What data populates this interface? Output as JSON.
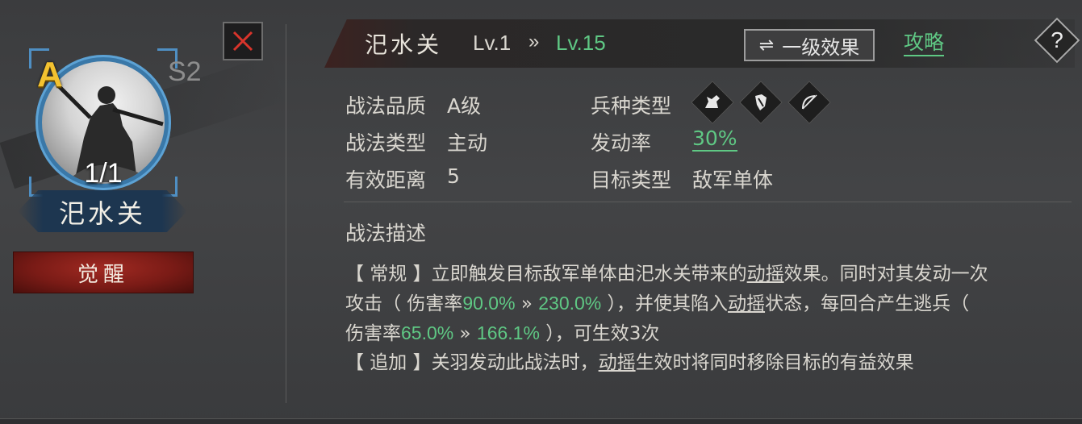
{
  "hero": {
    "grade": "A",
    "season": "S2",
    "count": "1/1",
    "name": "汜水关",
    "awaken_label": "觉醒"
  },
  "header": {
    "skill_name": "汜水关",
    "level_from": "Lv.1",
    "level_arrow": "»",
    "level_to": "Lv.15",
    "effect_button_icon": "⇌",
    "effect_button_label": "一级效果",
    "guide_link": "攻略",
    "help_label": "?"
  },
  "info": {
    "quality_label": "战法品质",
    "quality_value": "A级",
    "type_label": "战法类型",
    "type_value": "主动",
    "range_label": "有效距离",
    "range_value": "5",
    "troop_label": "兵种类型",
    "troop_icons": [
      "cavalry-icon",
      "shield-icon",
      "bow-icon"
    ],
    "rate_label": "发动率",
    "rate_value": "30%",
    "target_label": "目标类型",
    "target_value": "敌军单体"
  },
  "description": {
    "title": "战法描述",
    "l1a": "【 常规 】立即触发目标敌军单体由汜水关带来的",
    "l1b": "动摇",
    "l1c": "效果。同时对其发动一次",
    "l2a": "攻击（ 伤害率",
    "l2b": "90.0%",
    "l2c": " » ",
    "l2d": "230.0%",
    "l2e": " ），并使其陷入",
    "l2f": "动摇",
    "l2g": "状态，每回合产生逃兵（",
    "l3a": "伤害率",
    "l3b": "65.0%",
    "l3c": " » ",
    "l3d": "166.1%",
    "l3e": " ），可生效3次",
    "l4a": "【 追加 】关羽发动此战法时，",
    "l4b": "动摇",
    "l4c": "生效时将同时移除目标的有益效果"
  }
}
